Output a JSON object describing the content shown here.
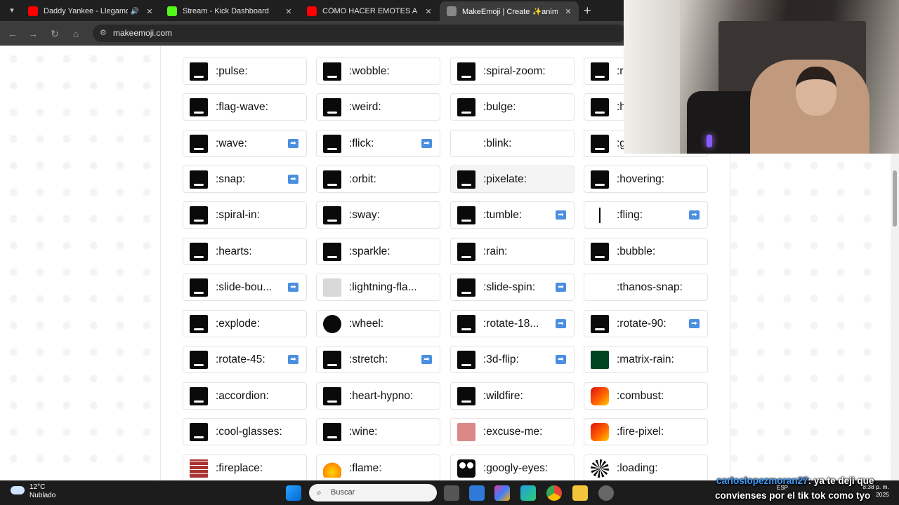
{
  "browser": {
    "tabs": [
      {
        "title": "Daddy Yankee - Llegamos a",
        "favicon": "youtube-icon",
        "color": "#ff0000",
        "active": false,
        "extra": "speaker-icon"
      },
      {
        "title": "Stream - Kick Dashboard",
        "favicon": "kick-icon",
        "color": "#53fc18",
        "active": false
      },
      {
        "title": "CÓMO HACER EMOTES ANIMA",
        "favicon": "youtube-icon",
        "color": "#ff0000",
        "active": false
      },
      {
        "title": "MakeEmoji | Create ✨animate",
        "favicon": "makeemoji-icon",
        "color": "#888888",
        "active": true
      }
    ],
    "url": "makeemoji.com"
  },
  "emotes": [
    [
      {
        "name": ":pulse:",
        "icon": "black"
      },
      {
        "name": ":wobble:",
        "icon": "black"
      },
      {
        "name": ":spiral-zoom:",
        "icon": "black"
      },
      {
        "name": ":r",
        "icon": "black"
      }
    ],
    [
      {
        "name": ":flag-wave:",
        "icon": "black"
      },
      {
        "name": ":weird:",
        "icon": "black"
      },
      {
        "name": ":bulge:",
        "icon": "black"
      },
      {
        "name": ":h",
        "icon": "black"
      }
    ],
    [
      {
        "name": ":wave:",
        "icon": "black",
        "arrow": true
      },
      {
        "name": ":flick:",
        "icon": "black",
        "arrow": true
      },
      {
        "name": ":blink:",
        "icon": "blank"
      },
      {
        "name": ":g",
        "icon": "black"
      }
    ],
    [
      {
        "name": ":snap:",
        "icon": "black",
        "arrow": true
      },
      {
        "name": ":orbit:",
        "icon": "black"
      },
      {
        "name": ":pixelate:",
        "icon": "black",
        "hover": true
      },
      {
        "name": ":hovering:",
        "icon": "black"
      }
    ],
    [
      {
        "name": ":spiral-in:",
        "icon": "black"
      },
      {
        "name": ":sway:",
        "icon": "black"
      },
      {
        "name": ":tumble:",
        "icon": "black",
        "arrow": true
      },
      {
        "name": ":fling:",
        "icon": "line",
        "arrow": true
      }
    ],
    [
      {
        "name": ":hearts:",
        "icon": "black"
      },
      {
        "name": ":sparkle:",
        "icon": "black"
      },
      {
        "name": ":rain:",
        "icon": "black"
      },
      {
        "name": ":bubble:",
        "icon": "black"
      }
    ],
    [
      {
        "name": ":slide-bou...",
        "icon": "black",
        "arrow": true
      },
      {
        "name": ":lightning-fla...",
        "icon": "grey"
      },
      {
        "name": ":slide-spin:",
        "icon": "black",
        "arrow": true
      },
      {
        "name": ":thanos-snap:",
        "icon": "blank"
      }
    ],
    [
      {
        "name": ":explode:",
        "icon": "black"
      },
      {
        "name": ":wheel:",
        "icon": "circle"
      },
      {
        "name": ":rotate-18...",
        "icon": "black",
        "arrow": true
      },
      {
        "name": ":rotate-90:",
        "icon": "black",
        "arrow": true
      }
    ],
    [
      {
        "name": ":rotate-45:",
        "icon": "black",
        "arrow": true
      },
      {
        "name": ":stretch:",
        "icon": "black",
        "arrow": true
      },
      {
        "name": ":3d-flip:",
        "icon": "black",
        "arrow": true
      },
      {
        "name": ":matrix-rain:",
        "icon": "matrix"
      }
    ],
    [
      {
        "name": ":accordion:",
        "icon": "black"
      },
      {
        "name": ":heart-hypno:",
        "icon": "black"
      },
      {
        "name": ":wildfire:",
        "icon": "black"
      },
      {
        "name": ":combust:",
        "icon": "fire"
      }
    ],
    [
      {
        "name": ":cool-glasses:",
        "icon": "black"
      },
      {
        "name": ":wine:",
        "icon": "black"
      },
      {
        "name": ":excuse-me:",
        "icon": "face"
      },
      {
        "name": ":fire-pixel:",
        "icon": "fire"
      }
    ],
    [
      {
        "name": ":fireplace:",
        "icon": "brick"
      },
      {
        "name": ":flame:",
        "icon": "flame"
      },
      {
        "name": ":googly-eyes:",
        "icon": "eyes"
      },
      {
        "name": ":loading:",
        "icon": "loading"
      }
    ]
  ],
  "taskbar": {
    "temperature": "12°C",
    "weather": "Nublado",
    "search_placeholder": "Buscar",
    "lang": "ESP",
    "time": "8:38 p. m.",
    "date": "2025"
  },
  "chat_overlay": {
    "user": "carloslopezmoran27",
    "message_line1": ": ya te deji que",
    "message_line2": "convienses por el tik tok como tyo"
  }
}
